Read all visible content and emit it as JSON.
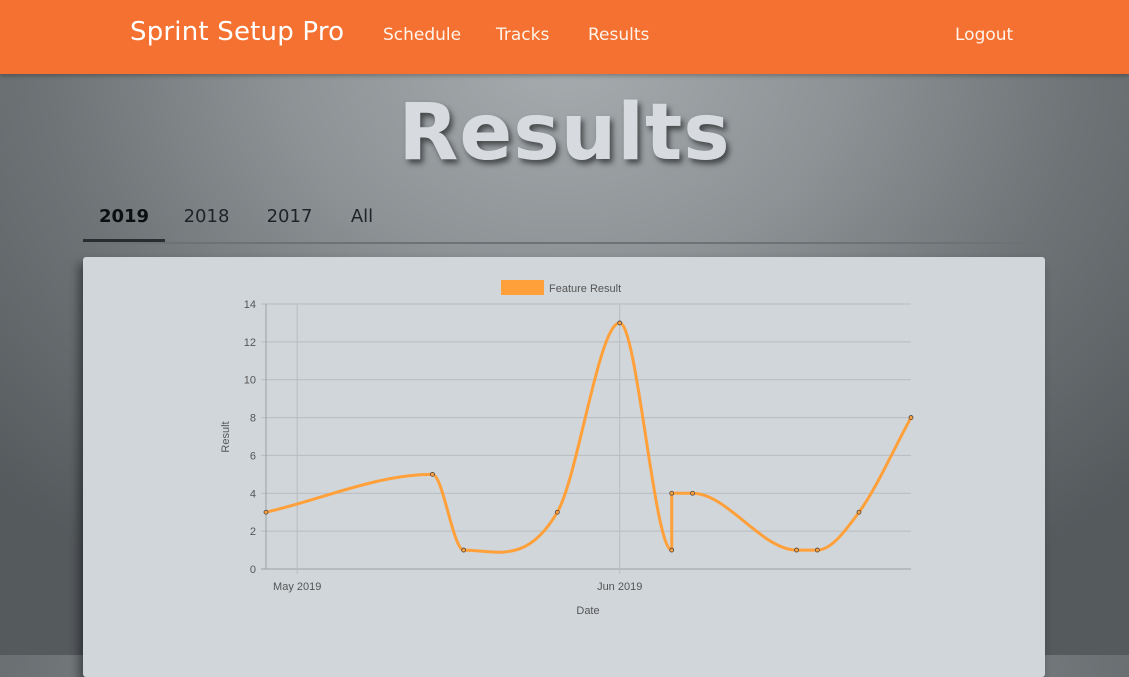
{
  "nav": {
    "brand": "Sprint Setup Pro",
    "links": [
      "Schedule",
      "Tracks",
      "Results"
    ],
    "logout": "Logout"
  },
  "page": {
    "heading": "Results"
  },
  "tabs": [
    {
      "label": "2019",
      "active": true
    },
    {
      "label": "2018",
      "active": false
    },
    {
      "label": "2017",
      "active": false
    },
    {
      "label": "All",
      "active": false
    }
  ],
  "colors": {
    "accent": "#f57131",
    "line": "#ffa03a"
  },
  "chart_data": {
    "type": "line",
    "legend": "Feature Result",
    "legend_position": "top-center",
    "xlabel": "Date",
    "ylabel": "Result",
    "ylim": [
      0,
      14
    ],
    "yticks": [
      "0",
      "2",
      "4",
      "6",
      "8",
      "10",
      "12",
      "14"
    ],
    "xticks": [
      "May 2019",
      "Jun 2019"
    ],
    "grid": true,
    "series": [
      {
        "name": "Feature Result",
        "x": [
          "2019-04-28",
          "2019-05-14",
          "2019-05-17",
          "2019-05-26",
          "2019-06-01",
          "2019-06-06",
          "2019-06-06",
          "2019-06-08",
          "2019-06-18",
          "2019-06-20",
          "2019-06-24",
          "2019-06-29"
        ],
        "y": [
          3,
          5,
          1,
          3,
          13,
          1,
          4,
          4,
          1,
          1,
          3,
          8
        ]
      }
    ]
  }
}
